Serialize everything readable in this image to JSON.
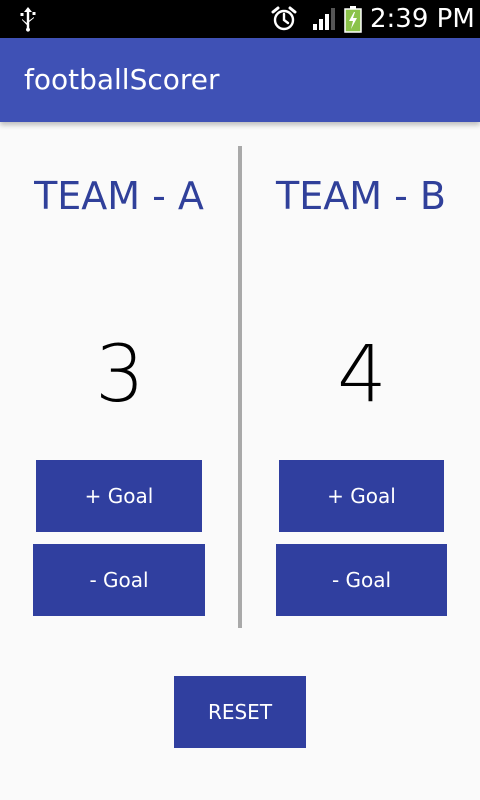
{
  "status_bar": {
    "time": "2:39 PM",
    "icons": [
      "usb-icon",
      "alarm-icon",
      "signal-icon",
      "battery-charging-icon"
    ]
  },
  "app_bar": {
    "title": "footballScorer",
    "color": "#3f51b5"
  },
  "team_a": {
    "name": "TEAM - A",
    "score": "3",
    "add_goal_label": "+ Goal",
    "remove_goal_label": "- Goal"
  },
  "team_b": {
    "name": "TEAM - B",
    "score": "4",
    "add_goal_label": "+ Goal",
    "remove_goal_label": "- Goal"
  },
  "reset_label": "RESET",
  "colors": {
    "button": "#303f9f",
    "team_name": "#30409a",
    "divider": "#a9a9a9",
    "background": "#fafafa"
  }
}
